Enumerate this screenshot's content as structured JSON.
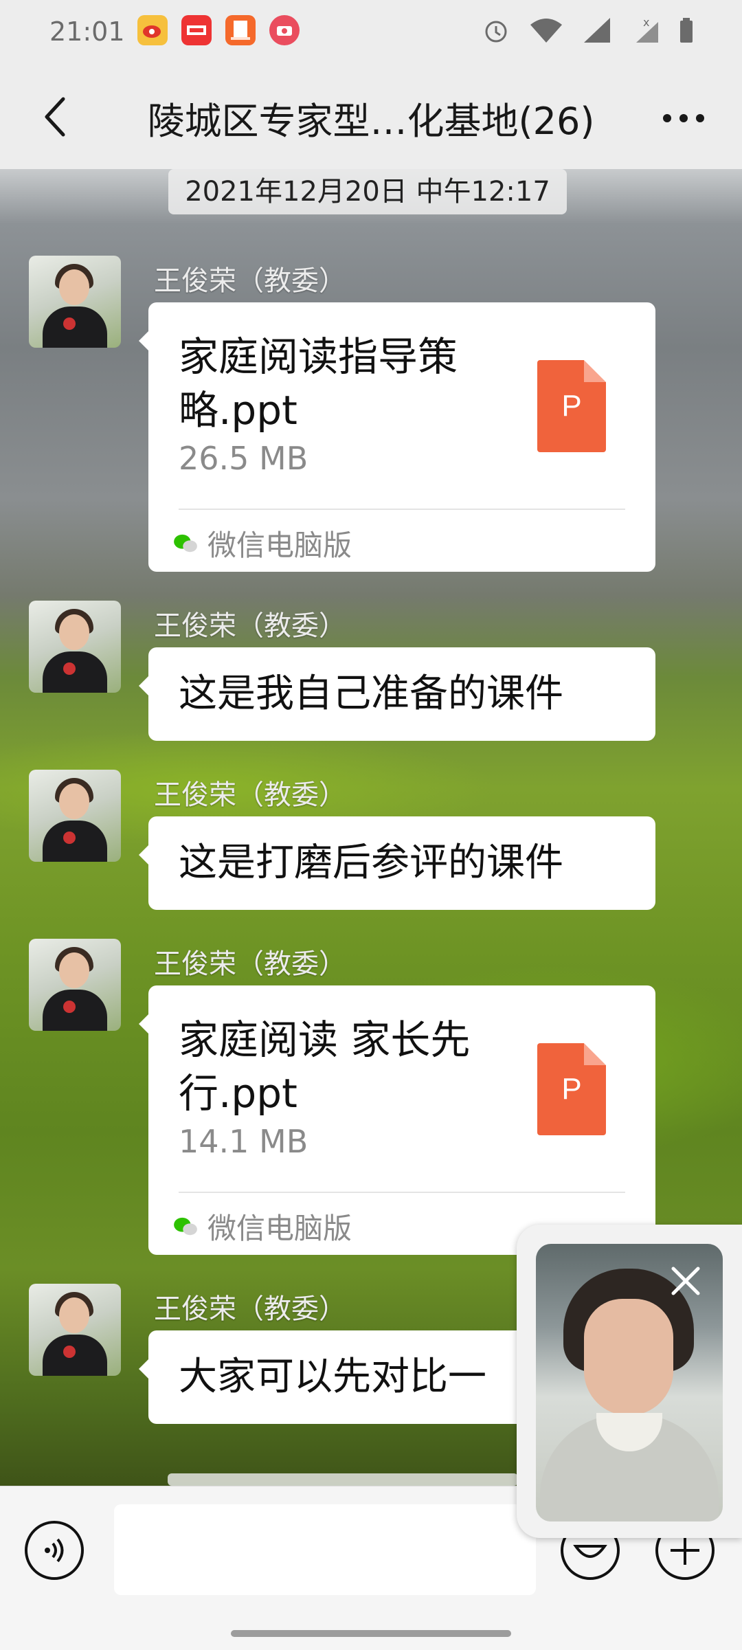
{
  "status_bar": {
    "time": "21:01",
    "apps": [
      "weibo-icon",
      "toutiao-icon",
      "app-icon",
      "camera-icon"
    ],
    "icons": [
      "alarm-icon",
      "wifi-icon",
      "signal-icon",
      "signal-x-icon",
      "battery-icon"
    ]
  },
  "header": {
    "title": "陵城区专家型…化基地(26)",
    "back_icon": "back-chevron-icon",
    "more_icon": "more-dots-icon"
  },
  "chat": {
    "timestamp": "2021年12月20日 中午12:17",
    "messages": [
      {
        "sender": "王俊荣（教委）",
        "type": "file",
        "file_name": "家庭阅读指导策略.ppt",
        "file_size": "26.5 MB",
        "file_type": "P",
        "source": "微信电脑版"
      },
      {
        "sender": "王俊荣（教委）",
        "type": "text",
        "text": "这是我自己准备的课件"
      },
      {
        "sender": "王俊荣（教委）",
        "type": "text",
        "text": "这是打磨后参评的课件"
      },
      {
        "sender": "王俊荣（教委）",
        "type": "file",
        "file_name": "家庭阅读 家长先行.ppt",
        "file_size": "14.1 MB",
        "file_type": "P",
        "source": "微信电脑版"
      },
      {
        "sender": "王俊荣（教委）",
        "type": "text",
        "text": "大家可以先对比一"
      }
    ]
  },
  "input_bar": {
    "voice_icon": "voice-icon",
    "emoji_icon": "emoji-icon",
    "plus_icon": "plus-icon"
  },
  "video_float": {
    "close_icon": "close-icon",
    "close_label": "✕"
  },
  "colors": {
    "bubble": "#ffffff",
    "ppt_icon": "#f0633c",
    "header_bg": "#ededed"
  }
}
